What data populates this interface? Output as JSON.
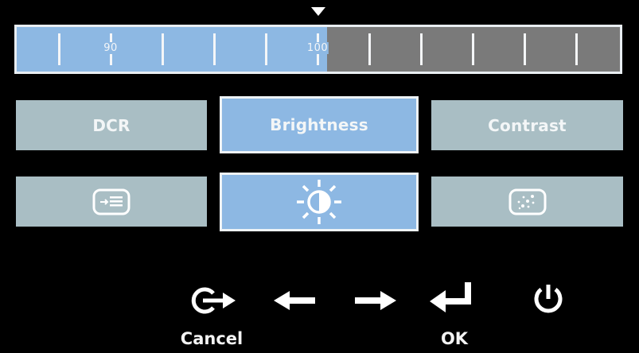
{
  "osd": {
    "slider": {
      "value_fraction": 0.515,
      "tick_labels": [
        "90",
        "100"
      ],
      "fill_color": "#8db8e3",
      "track_color": "#7a7a7a"
    },
    "tiles": [
      {
        "label": "DCR",
        "selected": false
      },
      {
        "label": "Brightness",
        "selected": true
      },
      {
        "label": "Contrast",
        "selected": false
      }
    ],
    "icon_tiles": [
      {
        "icon": "input-source-icon",
        "selected": false
      },
      {
        "icon": "brightness-sun-icon",
        "selected": true
      },
      {
        "icon": "contrast-color-icon",
        "selected": false
      }
    ],
    "controls": {
      "cancel_label": "Cancel",
      "ok_label": "OK"
    },
    "colors": {
      "selected": "#8db8e3",
      "unselected": "#a9bec4",
      "background": "#000000"
    }
  }
}
